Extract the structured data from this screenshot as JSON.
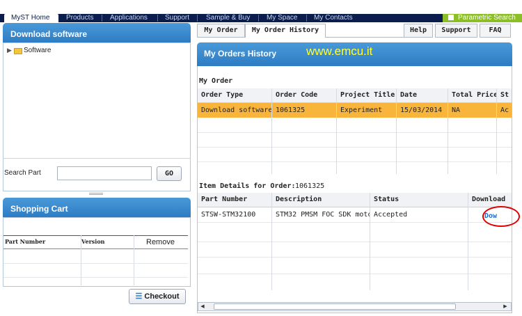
{
  "nav": {
    "items": [
      "MyST Home",
      "Products",
      "Applications",
      "Support",
      "Sample & Buy",
      "My Space",
      "My Contacts"
    ],
    "parametric_search": "Parametric Search"
  },
  "download_panel": {
    "title": "Download software",
    "tree_root": "Software",
    "search_label": "Search Part",
    "search_value": "",
    "go_label": "GO"
  },
  "cart": {
    "title": "Shopping Cart",
    "columns": [
      "Part Number",
      "Version",
      "Remove"
    ],
    "checkout_label": "Checkout"
  },
  "tabs": {
    "my_order": "My Order",
    "my_order_history": "My Order History",
    "help": "Help",
    "support": "Support",
    "faq": "FAQ"
  },
  "history": {
    "title": "My Orders History",
    "watermark": "www.emcu.it",
    "section": "My Order",
    "columns": [
      "Order Type",
      "Order Code",
      "Project Title",
      "Date",
      "Total Price",
      "St"
    ],
    "rows": [
      [
        "Download software",
        "1061325",
        "Experiment",
        "15/03/2014",
        "NA",
        "Ac"
      ]
    ]
  },
  "items": {
    "label": "Item Details for Order:",
    "order_code": "1061325",
    "columns": [
      "Part Number",
      "Description",
      "Status",
      "Download"
    ],
    "rows": [
      [
        "STSW-STM32100",
        "STM32 PMSM FOC SDK moto",
        "Accepted",
        "Dow"
      ]
    ]
  },
  "colors": {
    "accent": "#2d7cc4",
    "selected_row": "#f9b43b",
    "highlight_circle": "#e00000",
    "parametric": "#8cbf26"
  }
}
